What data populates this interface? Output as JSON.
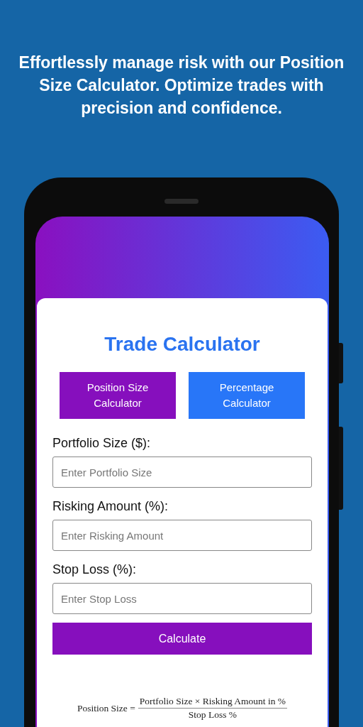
{
  "headline": "Effortlessly manage risk with our Position Size Calculator. Optimize trades with precision and confidence.",
  "app_title": "Trade Calculator",
  "tabs": [
    {
      "label": "Position Size Calculator",
      "selected": true
    },
    {
      "label": "Percentage Calculator",
      "selected": false
    }
  ],
  "fields": [
    {
      "label": "Portfolio Size ($):",
      "placeholder": "Enter Portfolio Size"
    },
    {
      "label": "Risking Amount (%):",
      "placeholder": "Enter Risking Amount"
    },
    {
      "label": "Stop Loss (%):",
      "placeholder": "Enter Stop Loss"
    }
  ],
  "calculate_button": "Calculate",
  "formula": {
    "lhs": "Position Size =",
    "numerator": "Portfolio Size × Risking Amount in %",
    "denominator": "Stop Loss %"
  }
}
